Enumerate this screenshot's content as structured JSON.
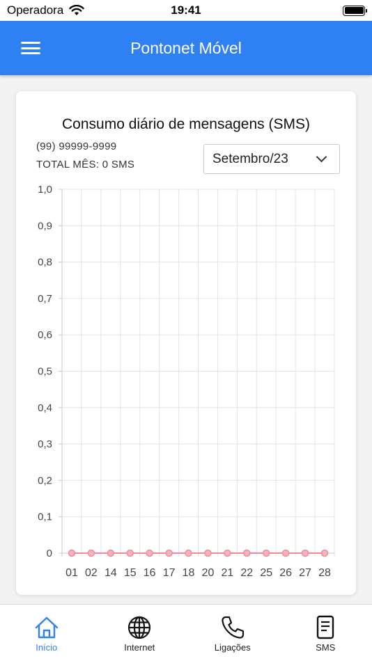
{
  "status_bar": {
    "carrier": "Operadora",
    "time": "19:41"
  },
  "app_bar": {
    "title": "Pontonet Móvel",
    "menu_icon": "hamburger-menu-icon"
  },
  "card": {
    "title": "Consumo diário de mensagens (SMS)",
    "phone_number": "(99) 99999-9999",
    "total_month": "TOTAL MÊS: 0 SMS",
    "month_select": {
      "selected": "Setembro/23"
    }
  },
  "chart_data": {
    "type": "line",
    "x": [
      "01",
      "02",
      "14",
      "15",
      "16",
      "17",
      "18",
      "20",
      "21",
      "22",
      "25",
      "26",
      "27",
      "28"
    ],
    "series": [
      {
        "values": [
          0,
          0,
          0,
          0,
          0,
          0,
          0,
          0,
          0,
          0,
          0,
          0,
          0,
          0
        ]
      }
    ],
    "y_ticks": [
      "0",
      "0,1",
      "0,2",
      "0,3",
      "0,4",
      "0,5",
      "0,6",
      "0,7",
      "0,8",
      "0,9",
      "1,0"
    ],
    "ylim": [
      0,
      1
    ],
    "grid": true,
    "colors": {
      "line": "#f08a9b",
      "grid": "#e3e3e3",
      "axis": "#c9c9c9"
    }
  },
  "bottom_nav": {
    "items": [
      {
        "label": "Início",
        "icon": "home-icon",
        "active": true
      },
      {
        "label": "Internet",
        "icon": "globe-icon",
        "active": false
      },
      {
        "label": "Ligações",
        "icon": "phone-icon",
        "active": false
      },
      {
        "label": "SMS",
        "icon": "document-icon",
        "active": false
      }
    ]
  },
  "colors": {
    "primary": "#2f80f3"
  }
}
